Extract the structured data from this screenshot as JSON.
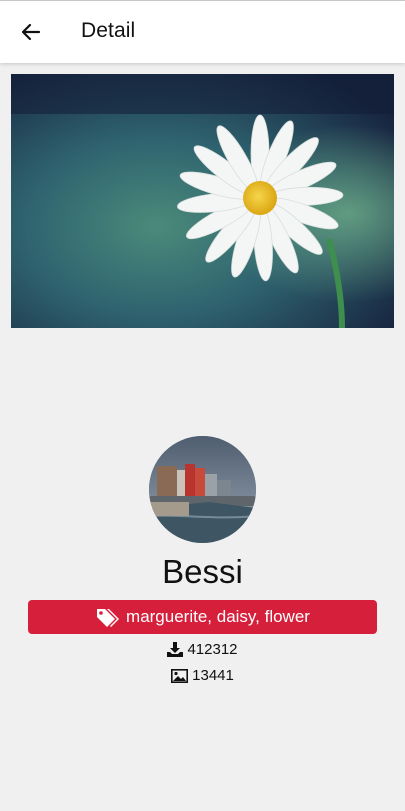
{
  "appbar": {
    "title": "Detail"
  },
  "user": {
    "name": "Bessi"
  },
  "tags": "marguerite, daisy, flower",
  "stats": {
    "downloads": "412312",
    "images": "13441"
  },
  "icons": {
    "back": "arrow-left-icon",
    "tags": "tags-icon",
    "downloads": "download-icon",
    "images": "image-icon"
  },
  "colors": {
    "tag_background": "#d61f3a",
    "appbar": "#ffffff",
    "page": "#f0f0f0"
  }
}
